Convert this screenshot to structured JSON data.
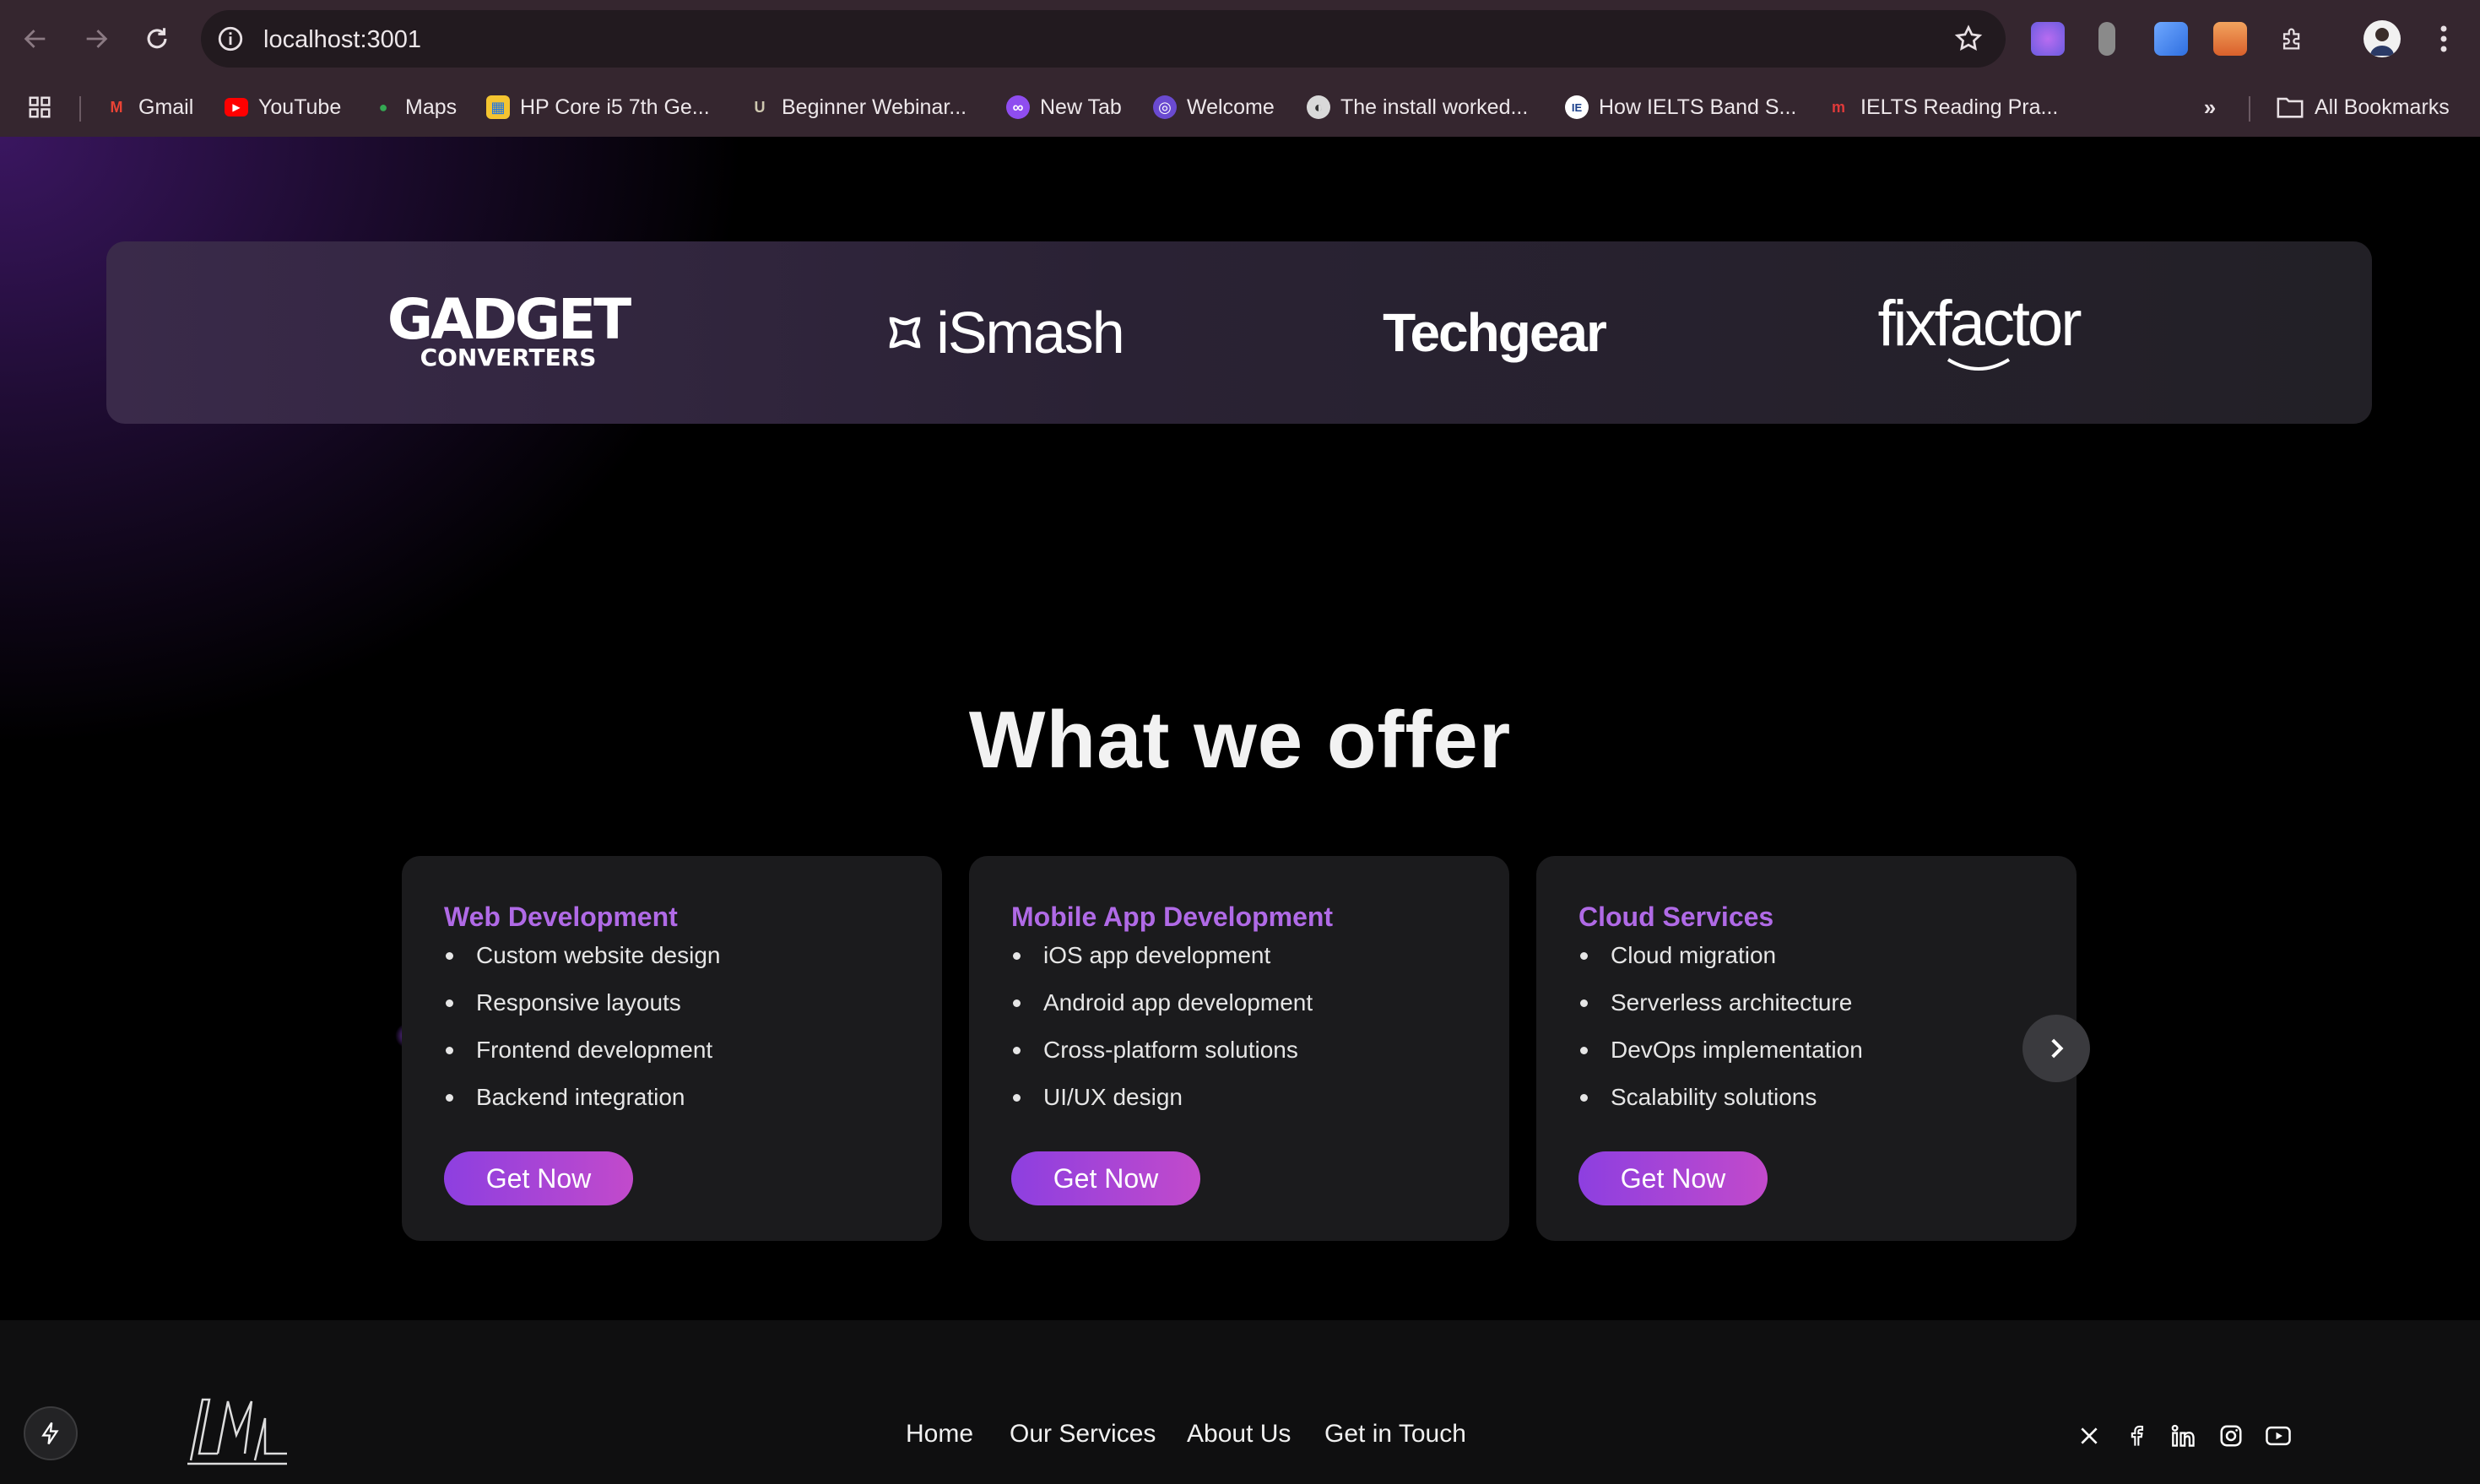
{
  "browser": {
    "url": "localhost:3001",
    "bookmarks": [
      {
        "label": "Gmail",
        "icon": "gmail-icon"
      },
      {
        "label": "YouTube",
        "icon": "youtube-icon"
      },
      {
        "label": "Maps",
        "icon": "maps-icon"
      },
      {
        "label": "HP Core i5 7th Ge...",
        "icon": "hp-icon"
      },
      {
        "label": "Beginner Webinar...",
        "icon": "webinar-icon"
      },
      {
        "label": "New Tab",
        "icon": "newtab-icon"
      },
      {
        "label": "Welcome",
        "icon": "welcome-icon"
      },
      {
        "label": "The install worked...",
        "icon": "globe-icon"
      },
      {
        "label": "How IELTS Band S...",
        "icon": "ielts-icon"
      },
      {
        "label": "IELTS Reading Pra...",
        "icon": "ielts-reading-icon"
      }
    ],
    "all_bookmarks": "All Bookmarks"
  },
  "partners": {
    "gadget_line1": "GADGET",
    "gadget_line2": "CONVERTERS",
    "ismash": "iSmash",
    "techgear": "Techgear",
    "fixfactor": "fixfactor"
  },
  "offer": {
    "title": "What we offer",
    "cards": [
      {
        "title": "Web Development",
        "items": [
          "Custom website design",
          "Responsive layouts",
          "Frontend development",
          "Backend integration"
        ],
        "button": "Get Now"
      },
      {
        "title": "Mobile App Development",
        "items": [
          "iOS app development",
          "Android app development",
          "Cross-platform solutions",
          "UI/UX design"
        ],
        "button": "Get Now"
      },
      {
        "title": "Cloud Services",
        "items": [
          "Cloud migration",
          "Serverless architecture",
          "DevOps implementation",
          "Scalability solutions"
        ],
        "button": "Get Now"
      }
    ]
  },
  "footer": {
    "nav": [
      "Home",
      "Our Services",
      "About Us",
      "Get in Touch"
    ],
    "social": [
      "x-icon",
      "facebook-icon",
      "linkedin-icon",
      "instagram-icon",
      "youtube-icon"
    ]
  },
  "colors": {
    "accent_purple": "#b06ae6",
    "button_gradient_start": "#8d3fe0",
    "button_gradient_end": "#c24acb",
    "card_bg": "#1b1b1d",
    "chrome_bg": "#35262f"
  }
}
